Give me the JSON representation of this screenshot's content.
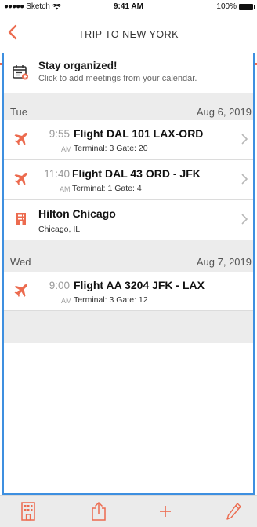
{
  "status": {
    "carrier": "Sketch",
    "time": "9:41 AM",
    "battery": "100%"
  },
  "nav": {
    "title": "TRIP TO NEW YORK",
    "accent": "#ec6b4f"
  },
  "banner": {
    "title": "Stay organized!",
    "subtitle": "Click to add meetings from your calendar."
  },
  "days": [
    {
      "name": "Tue",
      "date": "Aug 6, 2019",
      "items": [
        {
          "type": "flight",
          "time": "9:55",
          "ampm": "AM",
          "title": "Flight DAL 101 LAX-ORD",
          "meta": "Terminal: 3   Gate: 20"
        },
        {
          "type": "flight",
          "time": "11:40",
          "ampm": "AM",
          "title": "Flight DAL 43 ORD - JFK",
          "meta": "Terminal: 1   Gate: 4"
        },
        {
          "type": "hotel",
          "title": "Hilton Chicago",
          "sub": "Chicago, IL"
        }
      ]
    },
    {
      "name": "Wed",
      "date": "Aug 7, 2019",
      "items": [
        {
          "type": "flight",
          "time": "9:00",
          "ampm": "AM",
          "title": "Flight AA 3204 JFK - LAX",
          "meta": "Terminal: 3   Gate: 12"
        }
      ]
    }
  ],
  "icons": {
    "back": "chevron-left-icon",
    "calendar": "calendar-icon",
    "flight": "airplane-icon",
    "hotel": "hotel-icon",
    "chevron": "chevron-right-icon",
    "tab_hotel": "hotel-icon",
    "tab_share": "share-icon",
    "tab_add": "plus-icon",
    "tab_edit": "pencil-icon"
  }
}
